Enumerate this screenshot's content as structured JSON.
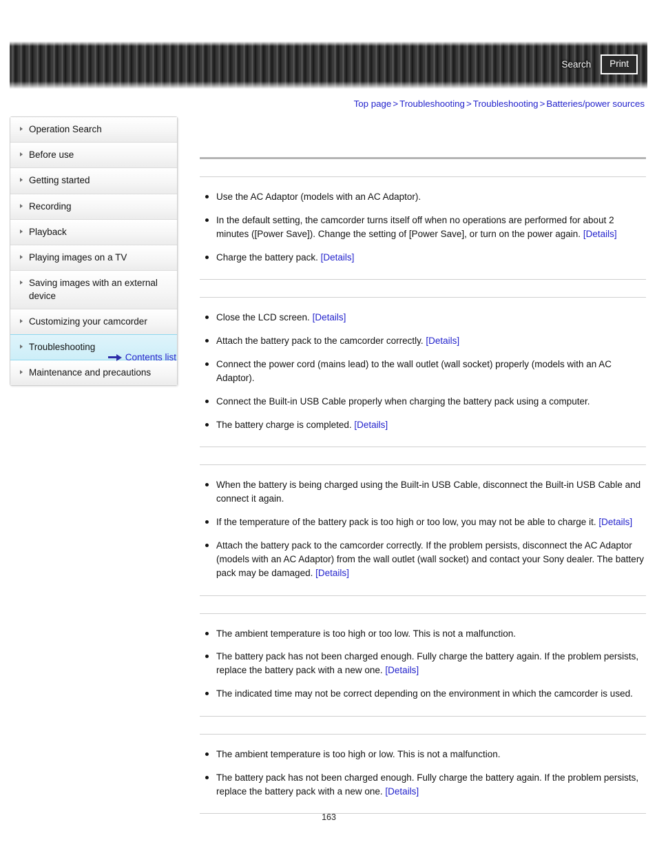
{
  "header": {
    "search_label": "Search",
    "print_label": "Print"
  },
  "breadcrumb": {
    "separator": ">",
    "items": [
      {
        "label": "Top page"
      },
      {
        "label": "Troubleshooting"
      },
      {
        "label": "Troubleshooting"
      },
      {
        "label": "Batteries/power sources"
      }
    ]
  },
  "sidebar": {
    "items": [
      {
        "label": "Operation Search",
        "active": false
      },
      {
        "label": "Before use",
        "active": false
      },
      {
        "label": "Getting started",
        "active": false
      },
      {
        "label": "Recording",
        "active": false
      },
      {
        "label": "Playback",
        "active": false
      },
      {
        "label": "Playing images on a TV",
        "active": false
      },
      {
        "label": "Saving images with an external device",
        "active": false
      },
      {
        "label": "Customizing your camcorder",
        "active": false
      },
      {
        "label": "Troubleshooting",
        "active": true
      },
      {
        "label": "Maintenance and precautions",
        "active": false
      }
    ],
    "contents_list_label": "Contents list",
    "contents_arrow_icon": "arrow-right-icon"
  },
  "main": {
    "page_title": "",
    "sections": [
      {
        "heading": "",
        "bullets": [
          {
            "text": "Use the AC Adaptor (models with an AC Adaptor).",
            "link": ""
          },
          {
            "text": "In the default setting, the camcorder turns itself off when no operations are performed for about 2 minutes ([Power Save]). Change the setting of [Power Save], or turn on the power again.",
            "link": "[Details]"
          },
          {
            "text": "Charge the battery pack.",
            "link": "[Details]"
          }
        ]
      },
      {
        "heading": "",
        "bullets": [
          {
            "text": "Close the LCD screen.",
            "link": "[Details]"
          },
          {
            "text": "Attach the battery pack to the camcorder correctly.",
            "link": "[Details]"
          },
          {
            "text": "Connect the power cord (mains lead) to the wall outlet (wall socket) properly (models with an AC Adaptor).",
            "link": ""
          },
          {
            "text": "Connect the Built-in USB Cable properly when charging the battery pack using a computer.",
            "link": ""
          },
          {
            "text": "The battery charge is completed.",
            "link": "[Details]"
          }
        ]
      },
      {
        "heading": "",
        "bullets": [
          {
            "text": "When the battery is being charged using the Built-in USB Cable, disconnect the Built-in USB Cable and connect it again.",
            "link": ""
          },
          {
            "text": "If the temperature of the battery pack is too high or too low, you may not be able to charge it.",
            "link": "[Details]"
          },
          {
            "text": "Attach the battery pack to the camcorder correctly. If the problem persists, disconnect the AC Adaptor (models with an AC Adaptor) from the wall outlet (wall socket) and contact your Sony dealer. The battery pack may be damaged.",
            "link": "[Details]"
          }
        ]
      },
      {
        "heading": "",
        "bullets": [
          {
            "text": "The ambient temperature is too high or too low. This is not a malfunction.",
            "link": ""
          },
          {
            "text": "The battery pack has not been charged enough. Fully charge the battery again. If the problem persists, replace the battery pack with a new one.",
            "link": "[Details]"
          },
          {
            "text": "The indicated time may not be correct depending on the environment in which the camcorder is used.",
            "link": ""
          }
        ]
      },
      {
        "heading": "",
        "bullets": [
          {
            "text": "The ambient temperature is too high or low. This is not a malfunction.",
            "link": ""
          },
          {
            "text": "The battery pack has not been charged enough. Fully charge the battery again. If the problem persists, replace the battery pack with a new one.",
            "link": "[Details]"
          }
        ]
      }
    ]
  },
  "footer": {
    "page_number": "163"
  },
  "colors": {
    "link": "#2222cc",
    "active_nav": "#cdeef8",
    "rule": "#cfcfcf",
    "header_dark": "#2b2b2b"
  }
}
